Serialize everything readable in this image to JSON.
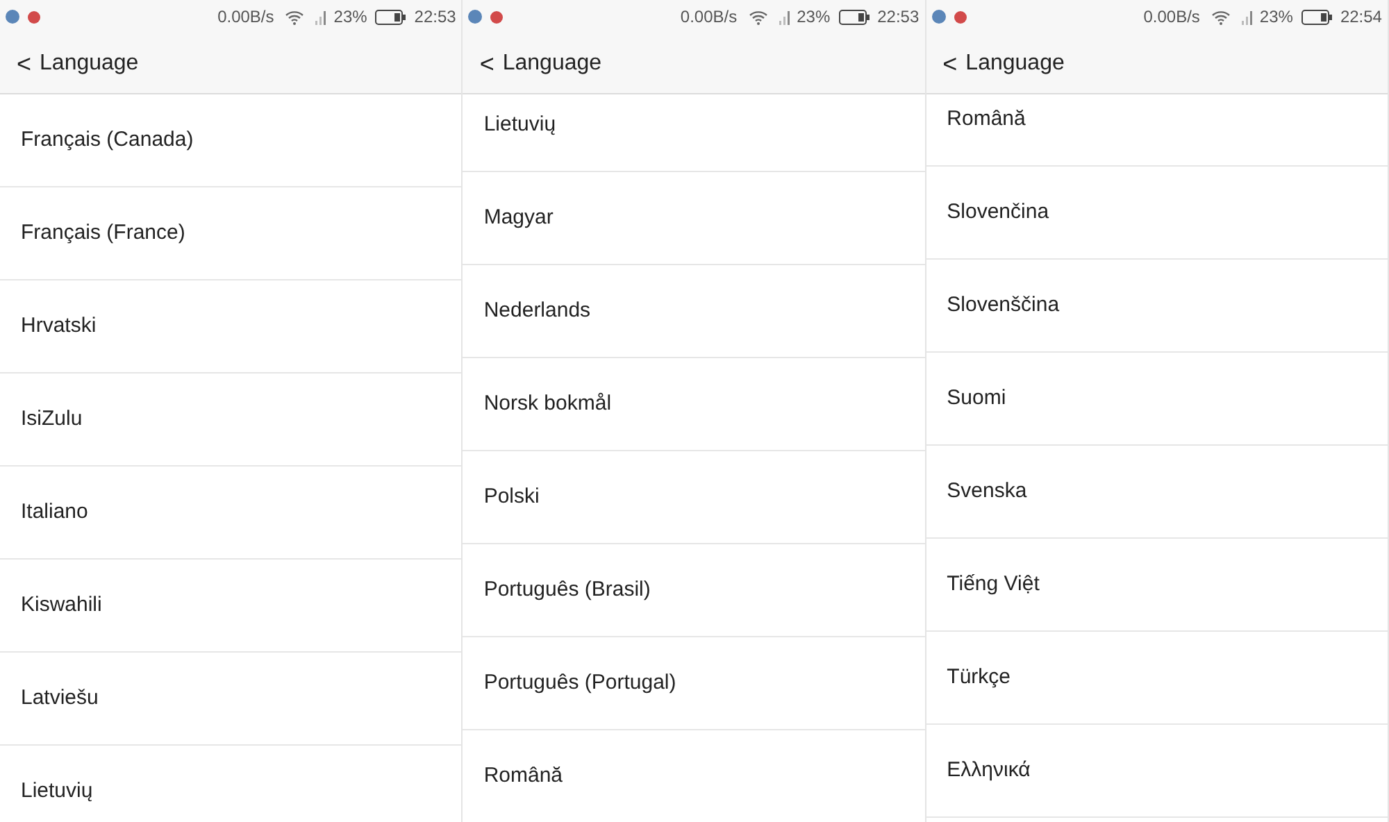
{
  "screens": [
    {
      "status_bar": {
        "speed": "0.00B/s",
        "battery": "23%",
        "time": "22:53"
      },
      "header": {
        "back": "<",
        "title": "Language"
      },
      "items": [
        "Français (Canada)",
        "Français (France)",
        "Hrvatski",
        "IsiZulu",
        "Italiano",
        "Kiswahili",
        "Latviešu",
        "Lietuvių"
      ]
    },
    {
      "status_bar": {
        "speed": "0.00B/s",
        "battery": "23%",
        "time": "22:53"
      },
      "header": {
        "back": "<",
        "title": "Language"
      },
      "items": [
        "Lietuvių",
        "Magyar",
        "Nederlands",
        "Norsk bokmål",
        "Polski",
        "Português (Brasil)",
        "Português (Portugal)",
        "Română"
      ]
    },
    {
      "status_bar": {
        "speed": "0.00B/s",
        "battery": "23%",
        "time": "22:54"
      },
      "header": {
        "back": "<",
        "title": "Language"
      },
      "items": [
        "Română",
        "Slovenčina",
        "Slovenščina",
        "Suomi",
        "Svenska",
        "Tiếng Việt",
        "Türkçe",
        "Ελληνικά"
      ]
    }
  ]
}
